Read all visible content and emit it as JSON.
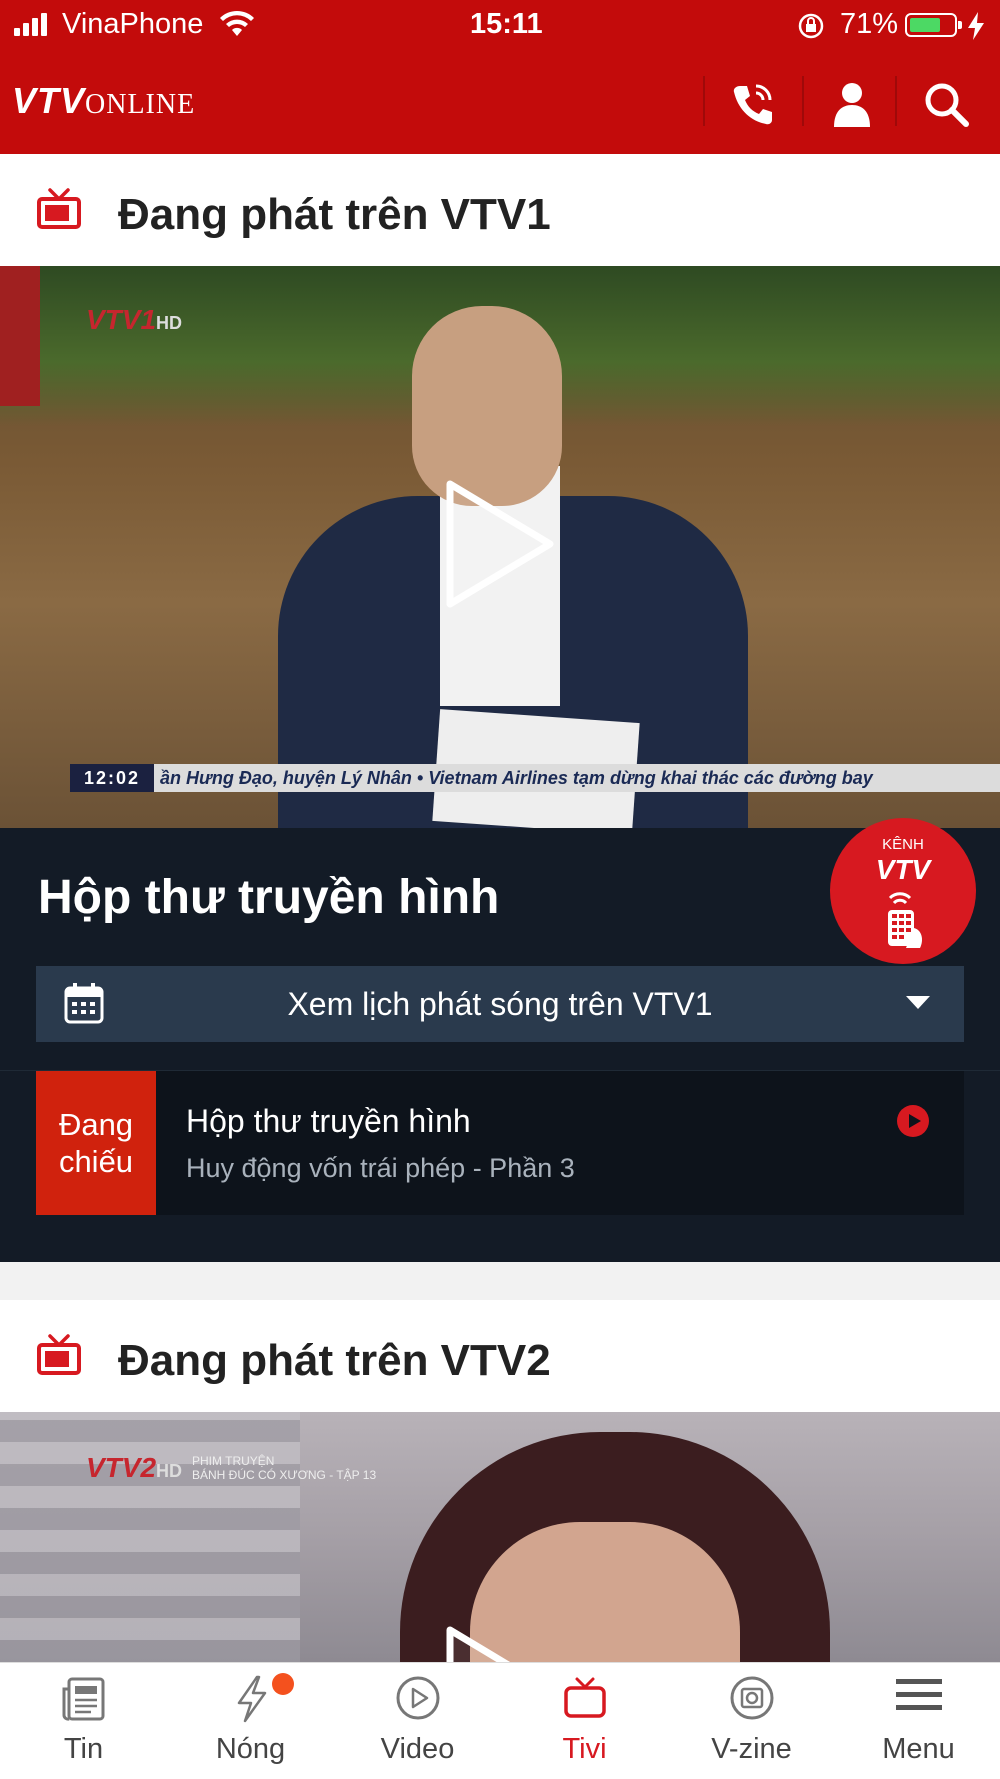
{
  "status_bar": {
    "carrier": "VinaPhone",
    "time": "15:11",
    "battery": "71%",
    "battery_level": 0.71
  },
  "header": {
    "logo_mark": "VTV",
    "logo_text": "ONLINE"
  },
  "vtv1": {
    "section_title": "Đang phát trên VTV1",
    "watermark": "VTV1",
    "watermark_hd": "HD",
    "ticker_time": "12:02",
    "ticker_text": "ần Hưng Đạo, huyện Lý Nhân  •  Vietnam Airlines tạm dừng khai thác các đường bay"
  },
  "inbox": {
    "title": "Hộp thư truyền hình",
    "badge_top": "KÊNH",
    "badge_mark": "VTV",
    "schedule_label": "Xem lịch phát sóng trên VTV1",
    "now_playing": {
      "status_line1": "Đang",
      "status_line2": "chiếu",
      "title": "Hộp thư truyền hình",
      "subtitle": "Huy động vốn trái phép - Phần 3"
    }
  },
  "vtv2": {
    "section_title": "Đang phát trên VTV2",
    "watermark": "VTV2",
    "watermark_hd": "HD",
    "caption_line1": "PHIM TRUYỆN",
    "caption_line2": "BÁNH ĐÚC CÓ XƯƠNG - TẬP 13"
  },
  "bottom_nav": [
    {
      "label": "Tin",
      "icon": "newspaper-icon"
    },
    {
      "label": "Nóng",
      "icon": "lightning-icon"
    },
    {
      "label": "Video",
      "icon": "play-circle-icon"
    },
    {
      "label": "Tivi",
      "icon": "tv-icon",
      "active": true
    },
    {
      "label": "V-zine",
      "icon": "camera-icon"
    },
    {
      "label": "Menu",
      "icon": "hamburger-icon"
    }
  ],
  "colors": {
    "brand_red": "#c30b0b",
    "accent_red": "#d71920",
    "dark_panel": "#131b26"
  }
}
